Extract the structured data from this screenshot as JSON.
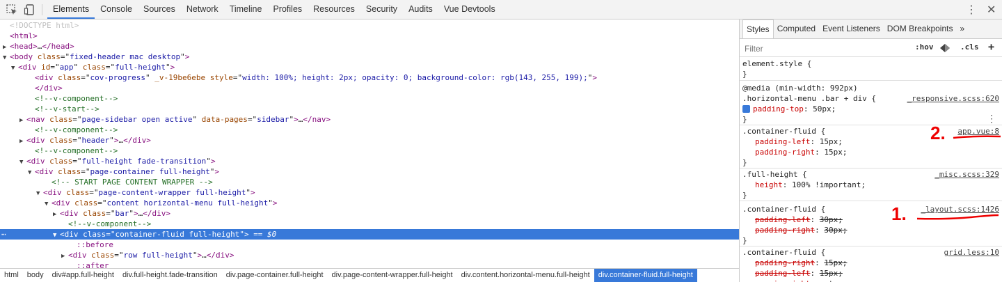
{
  "toolbar": {
    "tabs": [
      "Elements",
      "Console",
      "Sources",
      "Network",
      "Timeline",
      "Profiles",
      "Resources",
      "Security",
      "Audits",
      "Vue Devtools"
    ],
    "active_tab": "Elements"
  },
  "dom_tree": {
    "lines": [
      {
        "indent": 0,
        "tri": "",
        "html": "<span class='doctype'>&lt;!DOCTYPE html&gt;</span>"
      },
      {
        "indent": 0,
        "tri": "",
        "html": "<span class='tag'>&lt;html&gt;</span>"
      },
      {
        "indent": 0,
        "tri": "▶",
        "html": "<span class='tag'>&lt;head&gt;</span>…<span class='tag'>&lt;/head&gt;</span>"
      },
      {
        "indent": 0,
        "tri": "▼",
        "html": "<span class='tag'>&lt;body</span> <span class='attr'>class</span>=\"<span class='val'>fixed-header mac desktop</span>\"<span class='tag'>&gt;</span>"
      },
      {
        "indent": 1,
        "tri": "▼",
        "html": "<span class='tag'>&lt;div</span> <span class='attr'>id</span>=\"<span class='val'>app</span>\" <span class='attr'>class</span>=\"<span class='val'>full-height</span>\"<span class='tag'>&gt;</span>"
      },
      {
        "indent": 3,
        "tri": "",
        "html": "<span class='tag'>&lt;div</span> <span class='attr'>class</span>=\"<span class='val'>cov-progress</span>\" <span class='attr'>_v-19be6ebe</span> <span class='attr'>style</span>=\"<span class='val'>width: 100%; height: 2px; opacity: 0; background-color: rgb(143, 255, 199);</span>\"<span class='tag'>&gt;</span>"
      },
      {
        "indent": 3,
        "tri": "",
        "html": "<span class='tag'>&lt;/div&gt;</span>"
      },
      {
        "indent": 3,
        "tri": "",
        "html": "<span class='comment'>&lt;!--v-component--&gt;</span>"
      },
      {
        "indent": 3,
        "tri": "",
        "html": "<span class='comment'>&lt;!--v-start--&gt;</span>"
      },
      {
        "indent": 2,
        "tri": "▶",
        "html": "<span class='tag'>&lt;nav</span> <span class='attr'>class</span>=\"<span class='val'>page-sidebar open active</span>\" <span class='attr'>data-pages</span>=\"<span class='val'>sidebar</span>\"<span class='tag'>&gt;</span>…<span class='tag'>&lt;/nav&gt;</span>"
      },
      {
        "indent": 3,
        "tri": "",
        "html": "<span class='comment'>&lt;!--v-component--&gt;</span>"
      },
      {
        "indent": 2,
        "tri": "▶",
        "html": "<span class='tag'>&lt;div</span> <span class='attr'>class</span>=\"<span class='val'>header</span>\"<span class='tag'>&gt;</span>…<span class='tag'>&lt;/div&gt;</span>"
      },
      {
        "indent": 3,
        "tri": "",
        "html": "<span class='comment'>&lt;!--v-component--&gt;</span>"
      },
      {
        "indent": 2,
        "tri": "▼",
        "html": "<span class='tag'>&lt;div</span> <span class='attr'>class</span>=\"<span class='val'>full-height fade-transition</span>\"<span class='tag'>&gt;</span>"
      },
      {
        "indent": 3,
        "tri": "▼",
        "html": "<span class='tag'>&lt;div</span> <span class='attr'>class</span>=\"<span class='val'>page-container full-height</span>\"<span class='tag'>&gt;</span>"
      },
      {
        "indent": 5,
        "tri": "",
        "html": "<span class='comment'>&lt;!-- START PAGE CONTENT WRAPPER --&gt;</span>"
      },
      {
        "indent": 4,
        "tri": "▼",
        "html": "<span class='tag'>&lt;div</span> <span class='attr'>class</span>=\"<span class='val'>page-content-wrapper full-height</span>\"<span class='tag'>&gt;</span>"
      },
      {
        "indent": 5,
        "tri": "▼",
        "html": "<span class='tag'>&lt;div</span> <span class='attr'>class</span>=\"<span class='val'>content horizontal-menu full-height</span>\"<span class='tag'>&gt;</span>"
      },
      {
        "indent": 6,
        "tri": "▶",
        "html": "<span class='tag'>&lt;div</span> <span class='attr'>class</span>=\"<span class='val'>bar</span>\"<span class='tag'>&gt;</span>…<span class='tag'>&lt;/div&gt;</span>"
      },
      {
        "indent": 7,
        "tri": "",
        "html": "<span class='comment'>&lt;!--v-component--&gt;</span>"
      },
      {
        "indent": 6,
        "tri": "▼",
        "selected": true,
        "html": "<span class='tag'>&lt;div</span> <span class='attr'>class</span>=\"<span class='val'>container-fluid full-height</span>\"<span class='tag'>&gt;</span> <span class='sel-suffix'>== $0</span>"
      },
      {
        "indent": 8,
        "tri": "",
        "html": "<span class='pseudo'>::before</span>"
      },
      {
        "indent": 7,
        "tri": "▶",
        "html": "<span class='tag'>&lt;div</span> <span class='attr'>class</span>=\"<span class='val'>row full-height</span>\"<span class='tag'>&gt;</span>…<span class='tag'>&lt;/div&gt;</span>"
      },
      {
        "indent": 8,
        "tri": "",
        "html": "<span class='pseudo'>::after</span>"
      }
    ]
  },
  "breadcrumbs": [
    "html",
    "body",
    "div#app.full-height",
    "div.full-height.fade-transition",
    "div.page-container.full-height",
    "div.page-content-wrapper.full-height",
    "div.content.horizontal-menu.full-height",
    "div.container-fluid.full-height"
  ],
  "sidebar": {
    "tabs": [
      "Styles",
      "Computed",
      "Event Listeners",
      "DOM Breakpoints",
      "»"
    ],
    "filter_placeholder": "Filter",
    "hov": ":hov",
    "cls": ".cls",
    "plus": "+"
  },
  "styles": {
    "element_style": "element.style {",
    "media": "@media (min-width: 992px)",
    "rules": [
      {
        "selector": ".horizontal-menu .bar + div {",
        "source": "_responsive.scss:620",
        "props": [
          {
            "name": "padding-top",
            "value": "50px;",
            "checked": true,
            "strike": false
          }
        ]
      },
      {
        "selector": ".container-fluid {",
        "source": "app.vue:8",
        "props": [
          {
            "name": "padding-left",
            "value": "15px;",
            "strike": false
          },
          {
            "name": "padding-right",
            "value": "15px;",
            "strike": false
          }
        ]
      },
      {
        "selector": ".full-height {",
        "source": "_misc.scss:329",
        "props": [
          {
            "name": "height",
            "value": "100% !important;",
            "strike": false
          }
        ]
      },
      {
        "selector": ".container-fluid {",
        "source": "_layout.scss:1426",
        "props": [
          {
            "name": "padding-left",
            "value": "30px;",
            "strike": true
          },
          {
            "name": "padding-right",
            "value": "30px;",
            "strike": true
          }
        ]
      },
      {
        "selector": ".container-fluid {",
        "source": "grid.less:10",
        "props": [
          {
            "name": "padding-right",
            "value": "15px;",
            "strike": true
          },
          {
            "name": "padding-left",
            "value": "15px;",
            "strike": true
          },
          {
            "name": "margin-right",
            "value": "auto;",
            "strike": true
          }
        ]
      }
    ],
    "close_brace": "}"
  },
  "annotations": {
    "one": "1.",
    "two": "2."
  },
  "colors": {
    "accent": "#3879d9",
    "annotation": "#e00000"
  }
}
